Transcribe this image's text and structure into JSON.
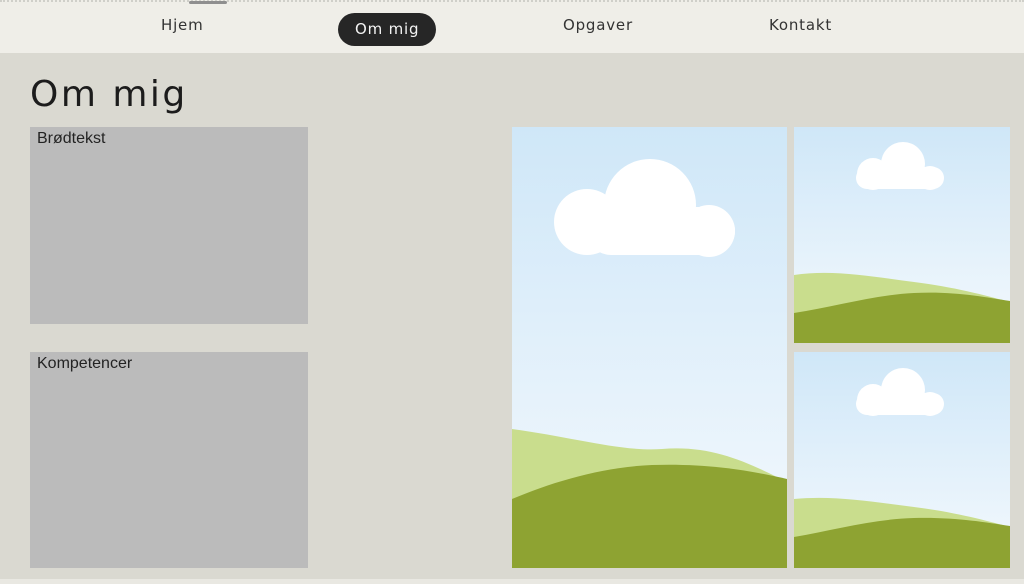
{
  "nav": {
    "items": [
      {
        "label": "Hjem",
        "active": false
      },
      {
        "label": "Om mig",
        "active": true
      },
      {
        "label": "Opgaver",
        "active": false
      },
      {
        "label": "Kontakt",
        "active": false
      }
    ]
  },
  "main": {
    "title": "Om mig",
    "panels": [
      {
        "label": "Brødtekst"
      },
      {
        "label": "Kompetencer"
      }
    ],
    "images": [
      {
        "icon": "landscape-placeholder-image"
      },
      {
        "icon": "landscape-placeholder-image"
      },
      {
        "icon": "landscape-placeholder-image"
      }
    ]
  },
  "colors": {
    "background": "#dad9d1",
    "nav_background": "#efeee8",
    "active_pill": "#262626",
    "panel": "#bbbbbb",
    "sky_top": "#cfe7f8",
    "sky_bottom": "#f4f9fd",
    "hill_light": "#c9dd8d",
    "hill_dark": "#8ea332",
    "cloud": "#ffffff"
  }
}
